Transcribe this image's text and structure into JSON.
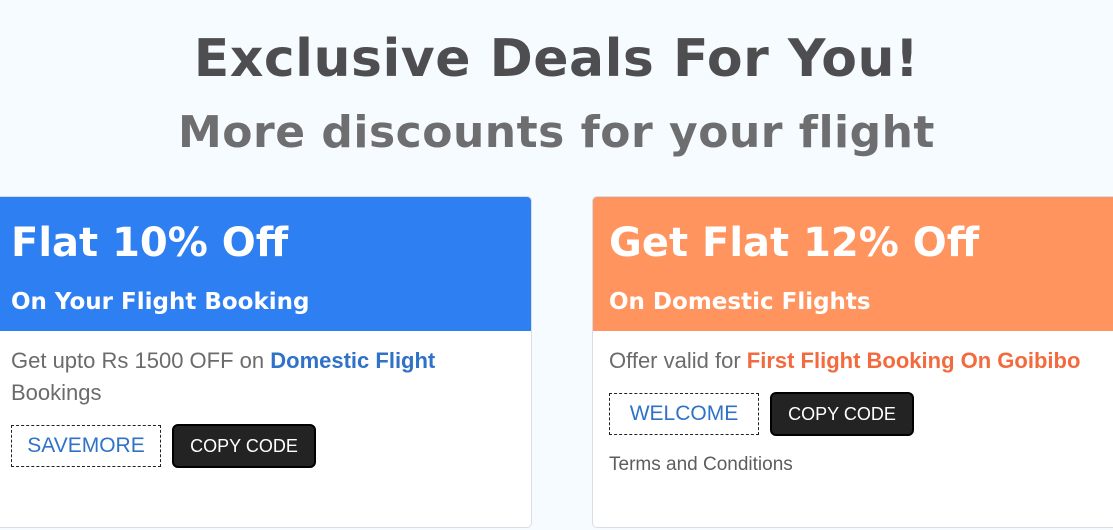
{
  "header": {
    "title": "Exclusive Deals For You!",
    "subtitle": "More discounts for your flight"
  },
  "offers": [
    {
      "heading": "Flat 10% Off",
      "subheading": "On Your Flight Booking",
      "desc_prefix": "Get upto Rs 1500 OFF on ",
      "desc_highlight": "Domestic Flight",
      "desc_suffix": " Bookings",
      "code": "SAVEMORE",
      "copy_label": "COPY CODE",
      "header_color": "#2e7ff1",
      "highlight_color": "#2f72c8"
    },
    {
      "heading": "Get Flat 12% Off",
      "subheading": "On Domestic Flights",
      "desc_prefix": "Offer valid for ",
      "desc_highlight": "First Flight Booking On Goibibo",
      "desc_suffix": "",
      "code": "WELCOME",
      "copy_label": "COPY CODE",
      "terms_label": "Terms and Conditions",
      "header_color": "#ff945f",
      "highlight_color": "#f26a3d"
    }
  ]
}
